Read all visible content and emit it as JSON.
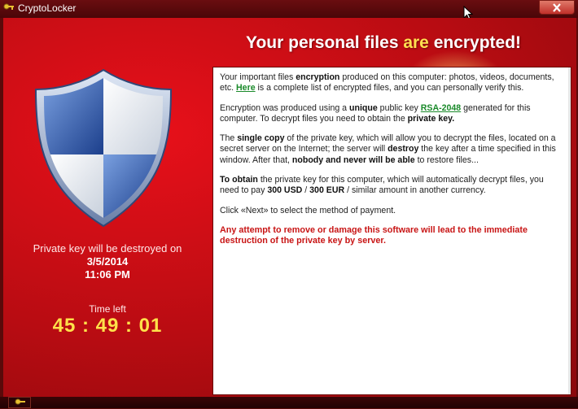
{
  "window": {
    "title": "CryptoLocker"
  },
  "header": {
    "title_part1": "Your personal files ",
    "title_part2": "are",
    "title_part3": " encrypted!"
  },
  "left": {
    "destroy_label": "Private key will be destroyed on",
    "destroy_date": "3/5/2014",
    "destroy_time": "11:06 PM",
    "time_left_label": "Time left",
    "countdown": "45 : 49 : 01"
  },
  "message": {
    "p1_a": "Your important files ",
    "p1_b": "encryption",
    "p1_c": " produced on this computer: photos, videos, documents, etc. ",
    "p1_link": "Here",
    "p1_d": " is a complete list of encrypted files, and you can personally verify this.",
    "p2_a": "Encryption was produced using a ",
    "p2_b": "unique",
    "p2_c": " public key ",
    "p2_link": "RSA-2048",
    "p2_d": " generated for this computer. To decrypt files you need to obtain the ",
    "p2_e": "private key.",
    "p3_a": "The ",
    "p3_b": "single copy",
    "p3_c": " of the private key, which will allow you to decrypt the files, located on a secret server on the Internet; the server will ",
    "p3_d": "destroy",
    "p3_e": " the key after a time specified in this window. After that, ",
    "p3_f": "nobody and never will be able",
    "p3_g": " to restore files...",
    "p4_a": "To obtain",
    "p4_b": " the private key for this computer, which will automatically decrypt files, you need to pay ",
    "p4_c": "300 USD",
    "p4_d": " / ",
    "p4_e": "300 EUR",
    "p4_f": " / similar amount in another currency.",
    "p5": "Click «Next» to select the method of payment.",
    "warning": "Any attempt to remove or damage this software will lead to the immediate destruction of the private key by server."
  },
  "icons": {
    "app": "key-icon",
    "close": "close-icon",
    "shield": "shield-icon",
    "cursor": "mouse-cursor-icon"
  },
  "colors": {
    "background_red": "#c50e15",
    "title_accent": "#ffe050",
    "countdown": "#ffe14a",
    "link": "#1a8a2a",
    "warning": "#c81414"
  }
}
